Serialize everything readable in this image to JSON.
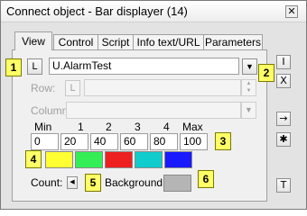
{
  "window": {
    "title": "Connect object - Bar displayer (14)",
    "close_label": "✕"
  },
  "tabs": [
    {
      "label": "View",
      "active": true
    },
    {
      "label": "Control",
      "active": false
    },
    {
      "label": "Script",
      "active": false
    },
    {
      "label": "Info text/URL",
      "active": false
    },
    {
      "label": "Parameters",
      "active": false
    }
  ],
  "object": {
    "l_button": "L",
    "value": "U.AlarmTest"
  },
  "row": {
    "label": "Row:",
    "l_button": "L"
  },
  "column": {
    "label": "Column:"
  },
  "thresholds": {
    "headers": [
      "Min",
      "1",
      "2",
      "3",
      "4",
      "Max"
    ],
    "values": [
      "0",
      "20",
      "40",
      "60",
      "80",
      "100"
    ],
    "colors": [
      "#ffff33",
      "#33ee55",
      "#ee1f1f",
      "#11cccc",
      "#1a1aff"
    ]
  },
  "count": {
    "label": "Count:"
  },
  "background": {
    "label": "Background:",
    "color": "#b5b5b5"
  },
  "side_buttons": [
    "I",
    "X",
    "→",
    "✱",
    "T"
  ],
  "callouts": [
    "1",
    "2",
    "3",
    "4",
    "5",
    "6"
  ]
}
